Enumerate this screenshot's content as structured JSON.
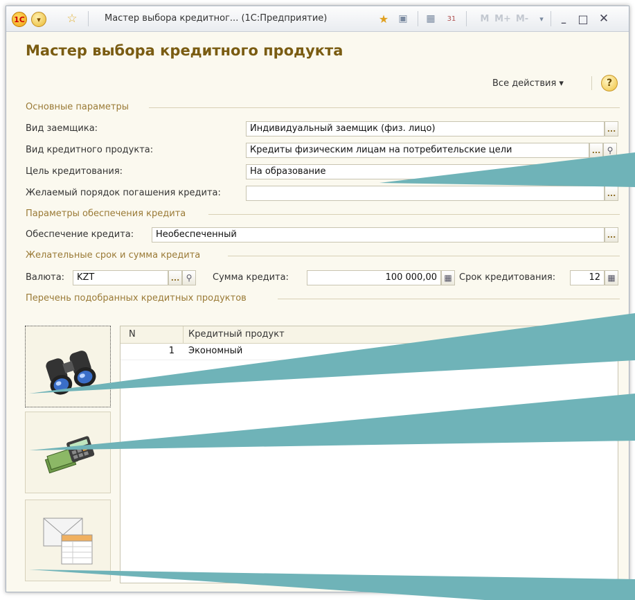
{
  "window": {
    "title": "Мастер выбора кредитног... (1С:Предприятие)",
    "toolbar_letters": [
      "M",
      "M+",
      "M-"
    ]
  },
  "page_title": "Мастер выбора кредитного продукта",
  "actions": {
    "all_actions_label": "Все действия ▾",
    "help": "?"
  },
  "sections": {
    "main": "Основные параметры",
    "security": "Параметры обеспечения кредита",
    "term": "Желательные срок и сумма кредита",
    "list": "Перечень подобранных кредитных продуктов"
  },
  "fields": {
    "borrower_type": {
      "label": "Вид заемщика:",
      "value": "Индивидуальный заемщик (физ. лицо)"
    },
    "product_type": {
      "label": "Вид кредитного продукта:",
      "value": "Кредиты физическим лицам на потребительские цели"
    },
    "purpose": {
      "label": "Цель кредитования:",
      "value": "На образование"
    },
    "repayment": {
      "label": "Желаемый порядок погашения кредита:",
      "value": ""
    },
    "security": {
      "label": "Обеспечение кредита:",
      "value": "Необеспеченный"
    },
    "currency": {
      "label": "Валюта:",
      "value": "KZT"
    },
    "amount": {
      "label": "Сумма кредита:",
      "value": "100 000,00"
    },
    "term": {
      "label": "Срок кредитования:",
      "value": "12"
    }
  },
  "buttons": {
    "ellipsis": "...",
    "search_icon": "search-icon",
    "calc_icon": "calculator-icon"
  },
  "side_buttons": [
    "binoculars-icon",
    "money-calculator-icon",
    "mail-report-icon"
  ],
  "table": {
    "columns": [
      "N",
      "Кредитный продукт"
    ],
    "rows": [
      {
        "n": "1",
        "product": "Экономный"
      }
    ]
  },
  "colors": {
    "title": "#7a5c12",
    "section": "#9a7a36",
    "background": "#fbf9ef",
    "callout": "#6fb3b8"
  }
}
